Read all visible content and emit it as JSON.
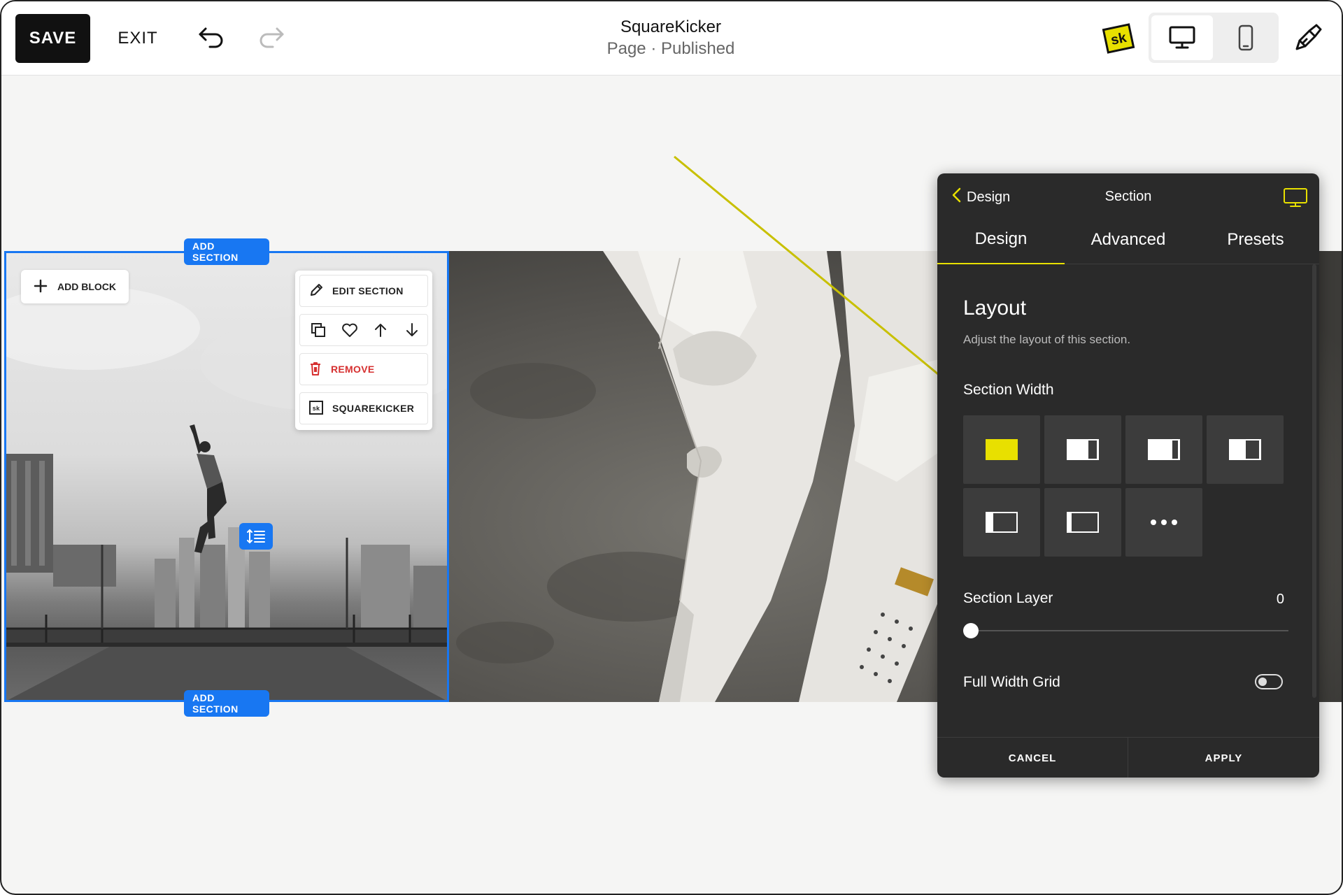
{
  "toolbar": {
    "save_label": "SAVE",
    "exit_label": "EXIT",
    "undo_icon": "undo-icon",
    "redo_icon": "redo-icon"
  },
  "header": {
    "title": "SquareKicker",
    "subtitle": "Page · Published",
    "logo_text": "sk",
    "logo_color": "#e8e000"
  },
  "device_toggle": {
    "selected": "desktop",
    "options": [
      "desktop",
      "mobile"
    ]
  },
  "canvas": {
    "add_section_top": "ADD SECTION",
    "add_section_bottom": "ADD SECTION",
    "add_block": "ADD BLOCK",
    "selection_color": "#1877f2"
  },
  "section_menu": {
    "edit_section": "EDIT SECTION",
    "remove": "REMOVE",
    "squarekicker": "SQUAREKICKER",
    "icon_row": [
      "duplicate-icon",
      "heart-icon",
      "arrow-up-icon",
      "arrow-down-icon"
    ]
  },
  "panel": {
    "back_label": "Design",
    "title": "Section",
    "tabs": [
      {
        "label": "Design",
        "active": true
      },
      {
        "label": "Advanced",
        "active": false
      },
      {
        "label": "Presets",
        "active": false
      }
    ],
    "layout_title": "Layout",
    "layout_subtitle": "Adjust the layout of this section.",
    "section_width_label": "Section Width",
    "section_width_selected": 0,
    "section_layer_label": "Section Layer",
    "section_layer_value": "0",
    "full_width_grid_label": "Full Width Grid",
    "full_width_grid_on": false,
    "cancel_label": "CANCEL",
    "apply_label": "APPLY",
    "accent_color": "#e8e000"
  }
}
